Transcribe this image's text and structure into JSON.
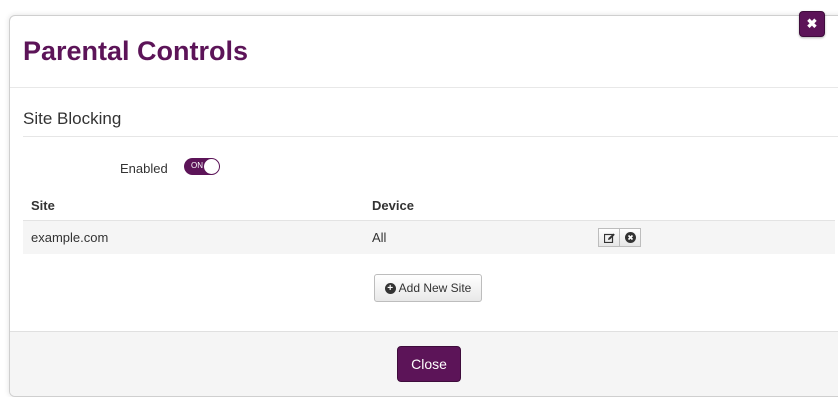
{
  "dialog": {
    "title": "Parental Controls",
    "close_icon_glyph": "✖"
  },
  "site_blocking": {
    "heading": "Site Blocking",
    "enabled_label": "Enabled",
    "toggle_state": "ON"
  },
  "table": {
    "headers": [
      "Site",
      "Device"
    ],
    "rows": [
      {
        "site": "example.com",
        "device": "All"
      }
    ],
    "row_actions": [
      "edit-icon",
      "remove-icon"
    ]
  },
  "buttons": {
    "add_new_site": "Add New Site",
    "close": "Close"
  },
  "colors": {
    "accent": "#5c1458",
    "footer_bg": "#f5f5f5",
    "row_bg": "#f5f5f5"
  }
}
